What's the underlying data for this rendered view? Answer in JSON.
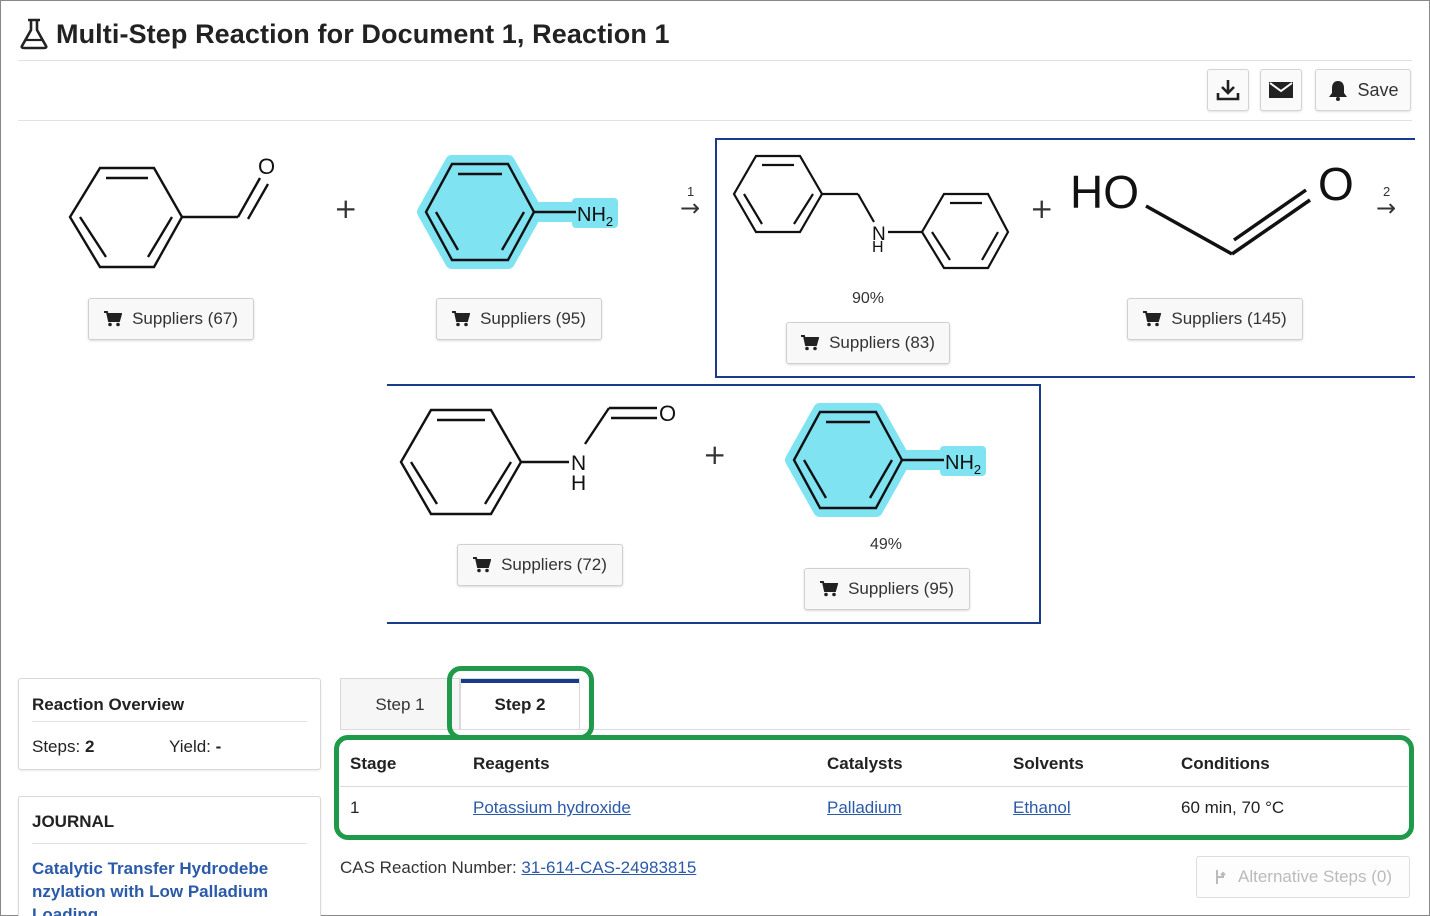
{
  "header": {
    "title": "Multi-Step Reaction for Document 1, Reaction 1",
    "icon": "flask-icon"
  },
  "toolbar": {
    "download_icon": "download-icon",
    "email_icon": "envelope-icon",
    "save_label": "Save",
    "save_icon": "bell-icon"
  },
  "reaction": {
    "plus": "+",
    "arrow": "→",
    "step1_number": "1",
    "step2_number": "2",
    "structures": {
      "aldehyde_o": "O",
      "nh2_main": "NH",
      "nh2_sub": "2",
      "n": "N",
      "h": "H",
      "ho": "HO",
      "o_big": "O",
      "o_small": "O"
    },
    "suppliers": [
      "Suppliers (67)",
      "Suppliers (95)",
      "Suppliers (83)",
      "Suppliers (145)",
      "Suppliers (72)",
      "Suppliers (95)"
    ],
    "yields": {
      "step1_product": "90%",
      "step2_product": "49%"
    },
    "highlight_color": "#7fe3f2",
    "box_color": "#1a3a8a"
  },
  "overview": {
    "title": "Reaction Overview",
    "steps_label": "Steps:",
    "steps_value": "2",
    "yield_label": "Yield:",
    "yield_value": "-"
  },
  "journal": {
    "title": "JOURNAL",
    "line1": "Catalytic Transfer Hydrodebe",
    "line2": "nzylation with Low Palladium",
    "line3": "Loading"
  },
  "tabs": [
    {
      "label": "Step 1"
    },
    {
      "label": "Step 2"
    }
  ],
  "table": {
    "headers": [
      "Stage",
      "Reagents",
      "Catalysts",
      "Solvents",
      "Conditions"
    ],
    "rows": [
      {
        "stage": "1",
        "reagents": "Potassium hydroxide",
        "catalysts": "Palladium",
        "solvents": "Ethanol",
        "conditions": "60 min, 70 °C"
      }
    ]
  },
  "cas": {
    "label": "CAS Reaction Number:",
    "value": "31-614-CAS-24983815"
  },
  "alternative": {
    "label": "Alternative Steps (0)"
  },
  "colors": {
    "accent": "#1a3a8a",
    "link": "#2a5aa8",
    "highlight_green": "#1e9a4a"
  }
}
